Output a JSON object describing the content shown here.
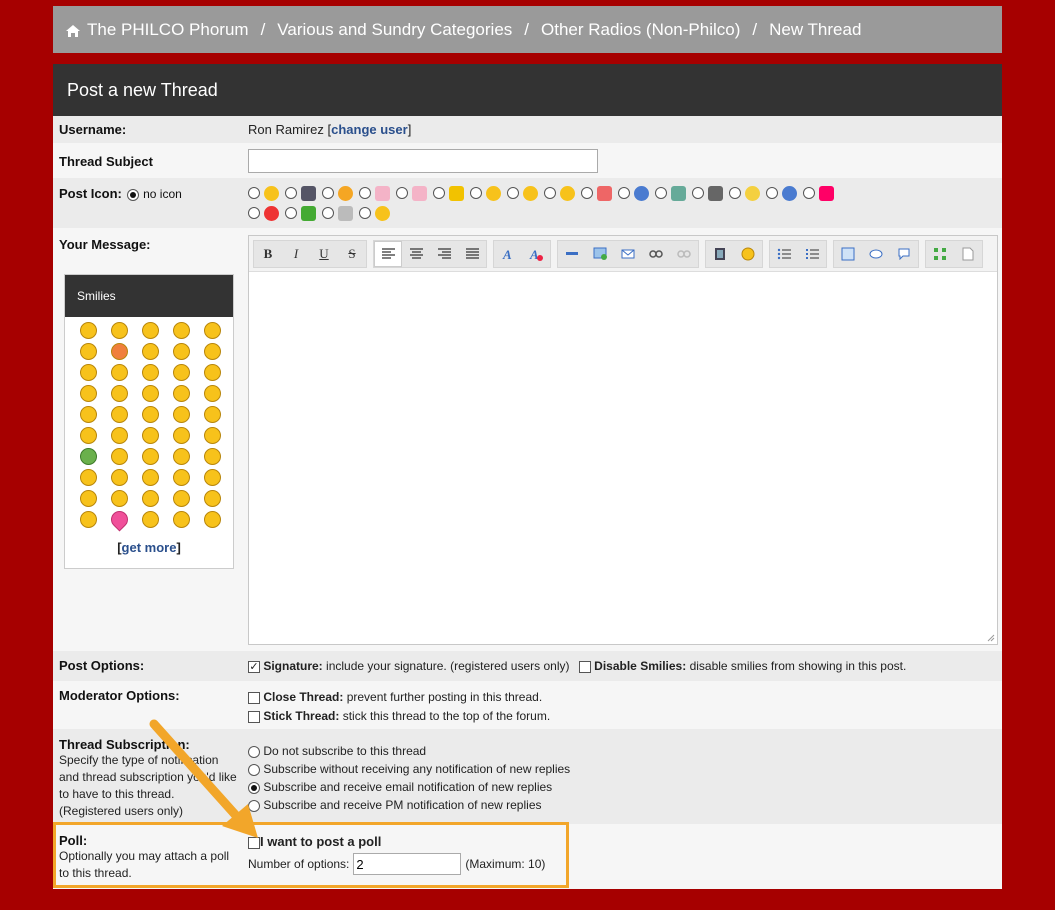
{
  "breadcrumb": {
    "items": [
      "The PHILCO Phorum",
      "Various and Sundry Categories",
      "Other Radios (Non-Philco)",
      "New Thread"
    ],
    "separator": "/"
  },
  "panel": {
    "title": "Post a new Thread"
  },
  "username": {
    "label": "Username:",
    "value": "Ron Ramirez",
    "change_link": "change user",
    "bracket_open": "[",
    "bracket_close": "]"
  },
  "subject": {
    "label": "Thread Subject",
    "value": ""
  },
  "post_icon": {
    "label": "Post Icon:",
    "no_icon_label": "no icon",
    "icons_row1": [
      "smile",
      "film",
      "wink",
      "thumbsup",
      "thumbsdown",
      "star",
      "grin",
      "surprised",
      "sad",
      "rainbow",
      "question",
      "picture",
      "music",
      "lightbulb",
      "info",
      "heart"
    ],
    "icons_row2": [
      "exclamation",
      "bug",
      "lego",
      "smile2"
    ]
  },
  "message": {
    "label": "Your Message:"
  },
  "toolbar": {
    "bold": "B",
    "italic": "I",
    "underline": "U",
    "strike": "S"
  },
  "smilies": {
    "title": "Smilies",
    "count": 50,
    "get_more": "get more",
    "bracket_open": "[",
    "bracket_close": "]"
  },
  "post_options": {
    "label": "Post Options:",
    "signature_bold": "Signature:",
    "signature_text": "include your signature. (registered users only)",
    "disable_bold": "Disable Smilies:",
    "disable_text": "disable smilies from showing in this post."
  },
  "moderator": {
    "label": "Moderator Options:",
    "close_bold": "Close Thread:",
    "close_text": "prevent further posting in this thread.",
    "stick_bold": "Stick Thread:",
    "stick_text": "stick this thread to the top of the forum."
  },
  "subscription": {
    "label": "Thread Subscription:",
    "desc": "Specify the type of notification and thread subscription you'd like to have to this thread. (Registered users only)",
    "options": [
      "Do not subscribe to this thread",
      "Subscribe without receiving any notification of new replies",
      "Subscribe and receive email notification of new replies",
      "Subscribe and receive PM notification of new replies"
    ]
  },
  "poll": {
    "label": "Poll:",
    "desc": "Optionally you may attach a poll to this thread.",
    "checkbox_label": "I want to post a poll",
    "num_label": "Number of options:",
    "num_value": "2",
    "max_text": "(Maximum: 10)"
  },
  "colors": {
    "background": "#a60000",
    "highlight": "#f2a62a",
    "link": "#2a4f8c"
  }
}
